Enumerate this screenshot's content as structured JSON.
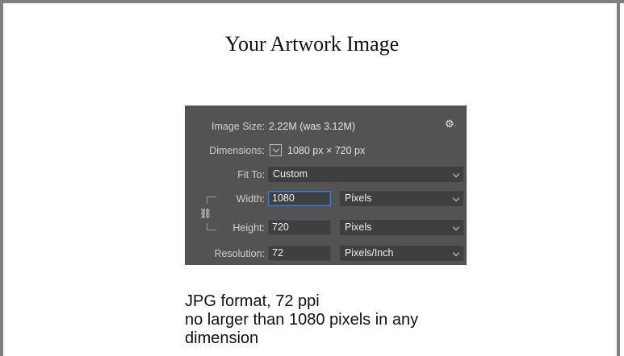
{
  "page": {
    "title": "Your Artwork Image",
    "caption_lines": [
      "JPG format, 72 ppi",
      "no larger than 1080 pixels in any",
      "dimension"
    ]
  },
  "dialog": {
    "image_size_label": "Image Size:",
    "image_size_value": "2.22M (was 3.12M)",
    "gear_icon": "⚙",
    "dimensions_label": "Dimensions:",
    "dimensions_value": "1080 px × 720 px",
    "fit_to_label": "Fit To:",
    "fit_to_value": "Custom",
    "width_label": "Width:",
    "width_value": "1080",
    "width_unit": "Pixels",
    "height_label": "Height:",
    "height_value": "720",
    "height_unit": "Pixels",
    "resolution_label": "Resolution:",
    "resolution_value": "72",
    "resolution_unit": "Pixels/Inch",
    "link_icon": "⛓"
  },
  "colors": {
    "frame": "#808080",
    "dialog_bg": "#535353",
    "field_bg": "#3f3f3f",
    "focus": "#3b7bd6"
  }
}
